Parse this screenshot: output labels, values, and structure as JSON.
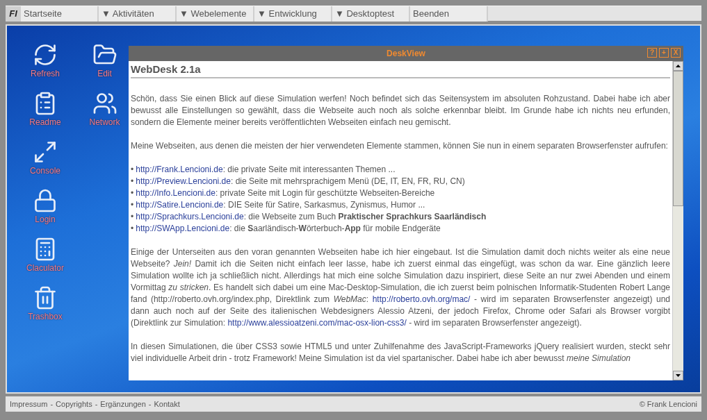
{
  "menu": {
    "logo": "Fl",
    "items": [
      "Startseite",
      "▼ Aktivitäten",
      "▼ Webelemente",
      "▼ Entwicklung",
      "▼ Desktoptest",
      "Beenden"
    ]
  },
  "desktop_icons": [
    {
      "label": "Refresh",
      "kind": "refresh"
    },
    {
      "label": "Edit",
      "kind": "folder"
    },
    {
      "label": "Readme",
      "kind": "clipboard"
    },
    {
      "label": "Network",
      "kind": "users"
    },
    {
      "label": "Console",
      "kind": "expand"
    },
    {
      "label": "Login",
      "kind": "lock"
    },
    {
      "label": "Claculator",
      "kind": "calculator"
    },
    {
      "label": "Trashbox",
      "kind": "trash"
    }
  ],
  "window": {
    "title": "DeskView",
    "buttons": [
      "?",
      "+",
      "X"
    ],
    "heading": "WebDesk 2.1a",
    "paragraph_1": "Schön, dass Sie einen Blick auf diese Simulation werfen! Noch befindet sich das Seitensystem im absoluten Rohzustand. Dabei habe ich aber bewusst alle Einstellungen so gewählt, dass die Webseite auch noch als solche erkennbar bleibt. Im Grunde habe ich nichts neu erfunden, sondern die Elemente meiner bereits veröffentlichten Webseiten einfach neu gemischt.",
    "paragraph_2": "Meine Webseiten, aus denen die meisten der hier verwendeten Elemente stammen, können Sie nun in einem separaten Browserfenster aufrufen:",
    "links": [
      {
        "bullet": "•",
        "url": "http://Frank.Lencioni.de",
        "text": ": die private Seite mit interessanten Themen ..."
      },
      {
        "bullet": "•",
        "url": "http://Preview.Lencioni.de",
        "text": ": die Seite mit mehrsprachigem Menü (DE, IT, EN, FR, RU, CN)"
      },
      {
        "bullet": "•",
        "url": "http://Info.Lencioni.de",
        "text": ": private Seite mit Login für geschützte Webseiten-Bereiche"
      },
      {
        "bullet": "•",
        "url": "http://Satire.Lencioni.de",
        "text": ": DIE Seite für Satire, Sarkasmus, Zynismus, Humor ..."
      },
      {
        "bullet": "•",
        "url": "http://Sprachkurs.Lencioni.de",
        "text": ": die Webseite zum Buch **Praktischer Sprachkurs Saarländisch**"
      },
      {
        "bullet": "•",
        "url": "http://SWApp.Lencioni.de",
        "text": ": die **S**aarländisch-**W**örterbuch-**App** für mobile Endgeräte"
      }
    ],
    "paragraph_3": [
      {
        "kind": "text",
        "text": "Einige der Unterseiten aus den voran genannten Webseiten habe ich hier eingebaut. Ist die Simulation damit doch nichts weiter als eine neue Webseite? *Jein!* Damit ich die Seiten nicht einfach leer lasse, habe ich zuerst einmal das eingefügt, was schon da war. Eine gänzlich leere Simulation wollte ich ja schließlich nicht. Allerdings hat mich eine solche Simulation dazu inspiriert, diese Seite an nur zwei Abenden und einem Vormittag *zu stricken*. Es handelt sich dabei um eine Mac-Desktop-Simulation, die ich zuerst beim polnischen Informatik-Studenten Robert Lange fand (http://roberto.ovh.org/index.php, Direktlink zum *WebMac*: "
      },
      {
        "kind": "link",
        "text": "http://roberto.ovh.org/mac/"
      },
      {
        "kind": "text",
        "text": " - wird im separaten Browserfenster angezeigt) und dann auch noch auf der Seite des italienischen Webdesigners Alessio Atzeni, der jedoch Firefox, Chrome oder Safari als Browser vorgibt (Direktlink zur Simulation: "
      },
      {
        "kind": "link",
        "text": "http://www.alessioatzeni.com/mac-osx-lion-css3/"
      },
      {
        "kind": "text",
        "text": " - wird im separaten Browserfenster angezeigt)."
      }
    ],
    "paragraph_4": "In diesen Simulationen, die über CSS3 sowie HTML5 und unter Zuhilfenahme des JavaScript-Frameworks jQuery realisiert wurden, steckt sehr viel individuelle Arbeit drin - trotz Framework! Meine Simulation ist da viel spartanischer. Dabei habe ich aber bewusst *meine Simulation*"
  },
  "footer": {
    "links": [
      "Impressum",
      "Copyrights",
      "Ergänzungen",
      "Kontakt"
    ],
    "separator": "-",
    "copyright": "© Frank Lencioni"
  }
}
